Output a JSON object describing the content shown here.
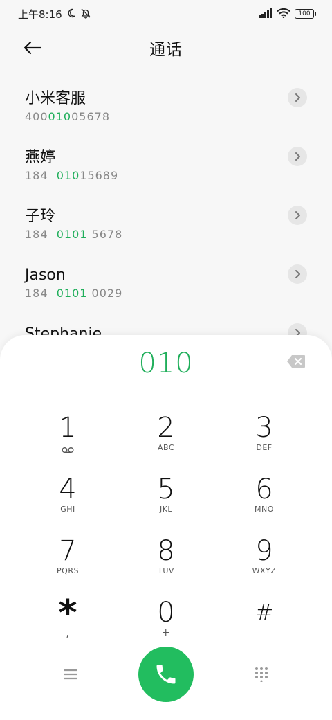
{
  "status_bar": {
    "time": "上午8:16",
    "battery": "100"
  },
  "header": {
    "title": "通话"
  },
  "contacts": [
    {
      "name": "小米客服",
      "number_pre": "400",
      "number_hl": "010",
      "number_post": "05678"
    },
    {
      "name": "燕婷",
      "number_pre": "184  ",
      "number_hl": "010",
      "number_post": "15689"
    },
    {
      "name": "子玲",
      "number_pre": "184  ",
      "number_hl": "0101",
      "number_post": " 5678"
    },
    {
      "name": "Jason",
      "number_pre": "184  ",
      "number_hl": "0101",
      "number_post": " 0029"
    },
    {
      "name": "Stephanie",
      "number_pre": "",
      "number_hl": "",
      "number_post": ""
    }
  ],
  "dialer": {
    "number": "010",
    "keys": [
      {
        "digit": "1",
        "letters": ""
      },
      {
        "digit": "2",
        "letters": "ABC"
      },
      {
        "digit": "3",
        "letters": "DEF"
      },
      {
        "digit": "4",
        "letters": "GHI"
      },
      {
        "digit": "5",
        "letters": "JKL"
      },
      {
        "digit": "6",
        "letters": "MNO"
      },
      {
        "digit": "7",
        "letters": "PQRS"
      },
      {
        "digit": "8",
        "letters": "TUV"
      },
      {
        "digit": "9",
        "letters": "WXYZ"
      },
      {
        "digit": "*",
        "letters": ","
      },
      {
        "digit": "0",
        "letters": "+"
      },
      {
        "digit": "#",
        "letters": ""
      }
    ]
  },
  "colors": {
    "accent": "#1fae5a",
    "call_button": "#22bd5f"
  },
  "icons": {
    "back": "arrow-left-icon",
    "chevron": "chevron-right-icon",
    "backspace": "backspace-icon",
    "voicemail": "voicemail-icon",
    "menu": "menu-icon",
    "call": "phone-icon",
    "keypad": "dialpad-icon"
  }
}
